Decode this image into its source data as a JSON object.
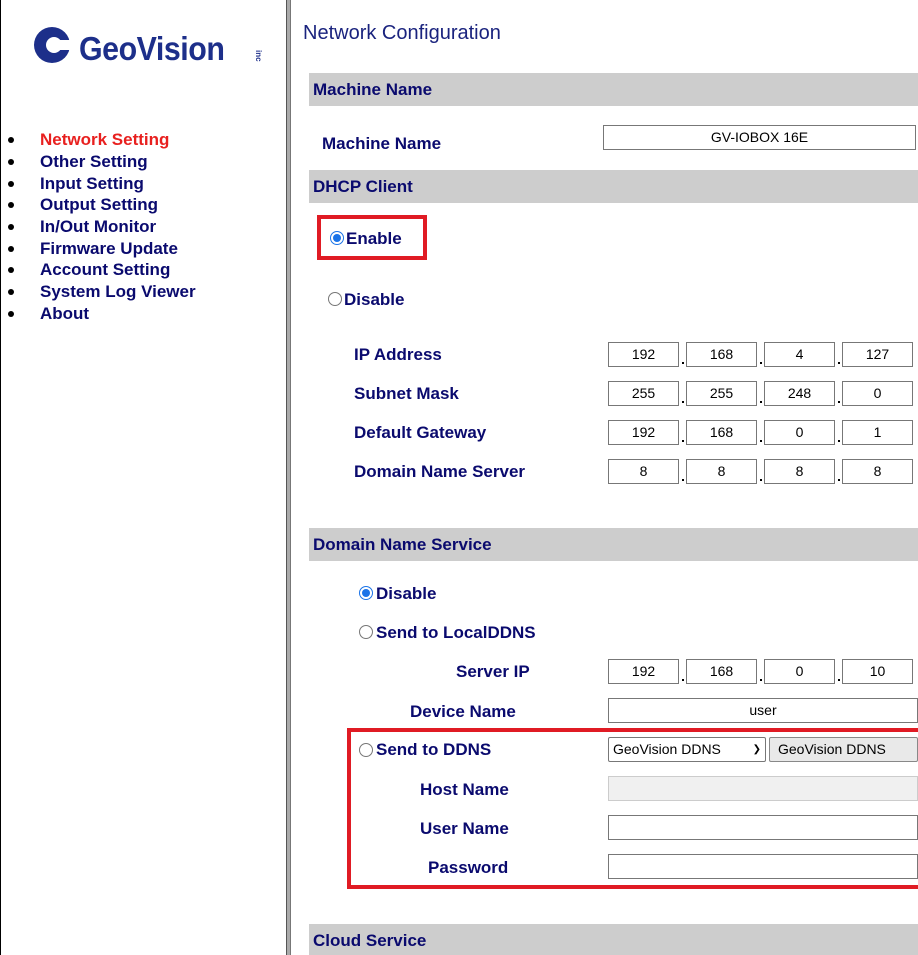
{
  "logo": {
    "text": "GeoVision",
    "inc": "inc"
  },
  "nav": [
    {
      "label": "Network Setting",
      "active": true
    },
    {
      "label": "Other Setting"
    },
    {
      "label": "Input Setting"
    },
    {
      "label": "Output Setting"
    },
    {
      "label": "In/Out Monitor"
    },
    {
      "label": "Firmware Update"
    },
    {
      "label": "Account Setting"
    },
    {
      "label": "System Log Viewer"
    },
    {
      "label": "About"
    }
  ],
  "page_title": "Network Configuration",
  "sections": {
    "machine_name": "Machine Name",
    "dhcp": "DHCP Client",
    "dns_service": "Domain Name Service",
    "cloud": "Cloud Service"
  },
  "machine": {
    "label": "Machine Name",
    "value": "GV-IOBOX 16E"
  },
  "dhcp": {
    "enable_label": "Enable",
    "disable_label": "Disable",
    "selected": "Enable",
    "ip_label": "IP Address",
    "ip": [
      "192",
      "168",
      "4",
      "127"
    ],
    "subnet_label": "Subnet Mask",
    "subnet": [
      "255",
      "255",
      "248",
      "0"
    ],
    "gateway_label": "Default Gateway",
    "gateway": [
      "192",
      "168",
      "0",
      "1"
    ],
    "dns_label": "Domain Name Server",
    "dns": [
      "8",
      "8",
      "8",
      "8"
    ]
  },
  "dns_service": {
    "disable_label": "Disable",
    "localddns_label": "Send to LocalDDNS",
    "selected": "Disable",
    "server_ip_label": "Server IP",
    "server_ip": [
      "192",
      "168",
      "0",
      "10"
    ],
    "device_name_label": "Device Name",
    "device_name": "user",
    "ddns_label": "Send to DDNS",
    "ddns_select": "GeoVision DDNS",
    "ddns_button": "GeoVision DDNS",
    "host_label": "Host Name",
    "host_value": "",
    "user_label": "User Name",
    "user_value": "",
    "password_label": "Password",
    "password_value": ""
  },
  "colors": {
    "nav_text": "#0a0a6e",
    "nav_active": "#e8201f",
    "section_bg": "#cdcdcd",
    "highlight": "#e01b24",
    "radio_accent": "#1a73e8",
    "logo": "#1d2f8a"
  }
}
